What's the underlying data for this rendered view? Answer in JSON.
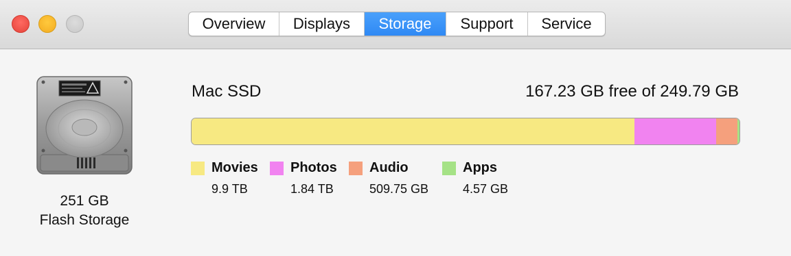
{
  "window": {
    "controls": [
      {
        "name": "close",
        "color": "#ff5f57"
      },
      {
        "name": "minimize",
        "color": "#febc2e"
      },
      {
        "name": "zoom",
        "color": "#d0d0d0"
      }
    ]
  },
  "tabs": [
    {
      "label": "Overview",
      "active": false
    },
    {
      "label": "Displays",
      "active": false
    },
    {
      "label": "Storage",
      "active": true
    },
    {
      "label": "Support",
      "active": false
    },
    {
      "label": "Service",
      "active": false
    }
  ],
  "drive": {
    "icon": "hard-drive-icon",
    "capacity": "251 GB",
    "type": "Flash Storage"
  },
  "volume": {
    "name": "Mac SSD",
    "free_text": "167.23 GB free of 249.79 GB"
  },
  "usage_bar": {
    "segments": [
      {
        "category": "Movies",
        "fraction": 0.808,
        "color": "#f7e982"
      },
      {
        "category": "Photos",
        "fraction": 0.15,
        "color": "#f183f0"
      },
      {
        "category": "Audio",
        "fraction": 0.038,
        "color": "#f5a07d"
      },
      {
        "category": "Apps",
        "fraction": 0.004,
        "color": "#a5e286"
      }
    ]
  },
  "legend": [
    {
      "label": "Movies",
      "size": "9.9 TB",
      "color": "#f7e982"
    },
    {
      "label": "Photos",
      "size": "1.84 TB",
      "color": "#f183f0"
    },
    {
      "label": "Audio",
      "size": "509.75 GB",
      "color": "#f5a07d"
    },
    {
      "label": "Apps",
      "size": "4.57 GB",
      "color": "#a5e286"
    }
  ]
}
